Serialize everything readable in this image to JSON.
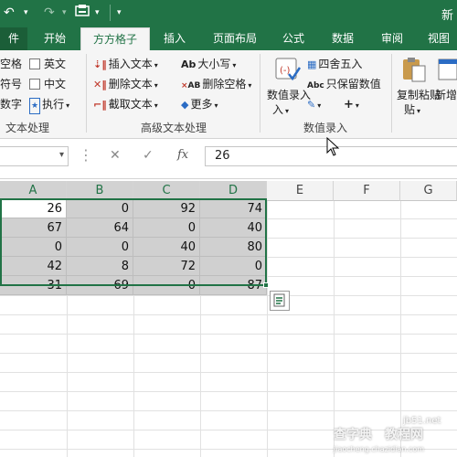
{
  "title_partial": "新",
  "tabs": [
    {
      "label": "件"
    },
    {
      "label": "开始"
    },
    {
      "label": "方方格子"
    },
    {
      "label": "插入"
    },
    {
      "label": "页面布局"
    },
    {
      "label": "公式"
    },
    {
      "label": "数据"
    },
    {
      "label": "审阅"
    },
    {
      "label": "视图"
    }
  ],
  "ribbon": {
    "text_group": {
      "items": [
        "空格",
        "符号",
        "数字",
        "英文",
        "中文",
        "执行"
      ],
      "label": "文本处理"
    },
    "advanced_group": {
      "insert": "插入文本",
      "delete": "删除文本",
      "extract": "截取文本",
      "case": "大小写",
      "delete_space": "删除空格",
      "more": "更多",
      "label": "高级文本处理"
    },
    "number_group": {
      "number_entry": "数值录入",
      "round": "四舍五入",
      "keep_number": "只保留数值",
      "label": "数值录入"
    },
    "paste_group": {
      "copy_paste": "复制粘贴",
      "new": "新增"
    }
  },
  "formula_bar": {
    "value": "26",
    "fx": "fx"
  },
  "columns": [
    "A",
    "B",
    "C",
    "D",
    "E",
    "F",
    "G"
  ],
  "rows": [
    [
      "26",
      "0",
      "92",
      "74"
    ],
    [
      "67",
      "64",
      "0",
      "40"
    ],
    [
      "0",
      "0",
      "40",
      "80"
    ],
    [
      "42",
      "8",
      "72",
      "0"
    ],
    [
      "31",
      "69",
      "0",
      "87"
    ]
  ],
  "watermark": {
    "line1": "查字典",
    "line2": "教程网",
    "site": "jb51.net",
    "url": "jiaocheng.chazidian.com"
  },
  "colors": {
    "accent": "#217346",
    "selection_fill": "#d0d0d0"
  }
}
